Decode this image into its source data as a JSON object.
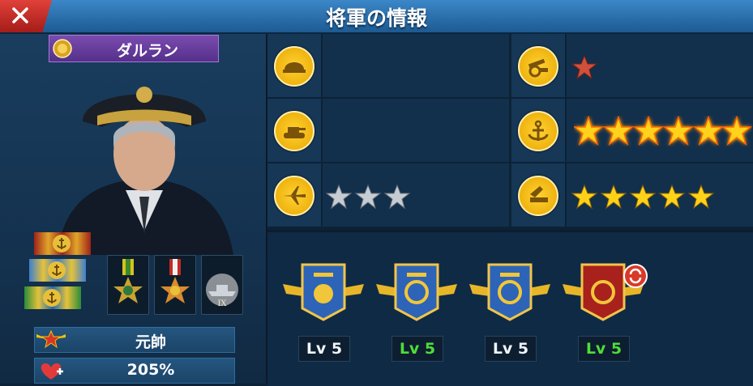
{
  "window": {
    "title": "将軍の情報"
  },
  "general": {
    "name": "ダルラン",
    "rank": "元帥",
    "bonus": "205%"
  },
  "branches": [
    {
      "icon": "infantry-helmet-icon",
      "stars": 0,
      "star_style": "none"
    },
    {
      "icon": "artillery-cannon-icon",
      "stars": 1,
      "star_style": "red"
    },
    {
      "icon": "tank-icon",
      "stars": 0,
      "star_style": "none"
    },
    {
      "icon": "navy-anchor-icon",
      "stars": 6,
      "star_style": "glowing-gold"
    },
    {
      "icon": "airplane-icon",
      "stars": 3,
      "star_style": "silver"
    },
    {
      "icon": "missile-icon",
      "stars": 5,
      "star_style": "gold"
    }
  ],
  "skills": [
    {
      "icon": "troops-skill-icon",
      "level": "Lv 5",
      "level_color": "#eef3f8"
    },
    {
      "icon": "ship-wheel-skill-icon",
      "level": "Lv 5",
      "level_color": "#4fdc3a"
    },
    {
      "icon": "ship-skill-icon",
      "level": "Lv 5",
      "level_color": "#eef3f8"
    },
    {
      "icon": "tank-skill-icon",
      "level": "Lv 5",
      "level_color": "#4fdc3a"
    }
  ],
  "colors": {
    "gold": "#f2c200",
    "purple_banner": "#6a3ea0",
    "header_blue": "#2f7bbd"
  }
}
